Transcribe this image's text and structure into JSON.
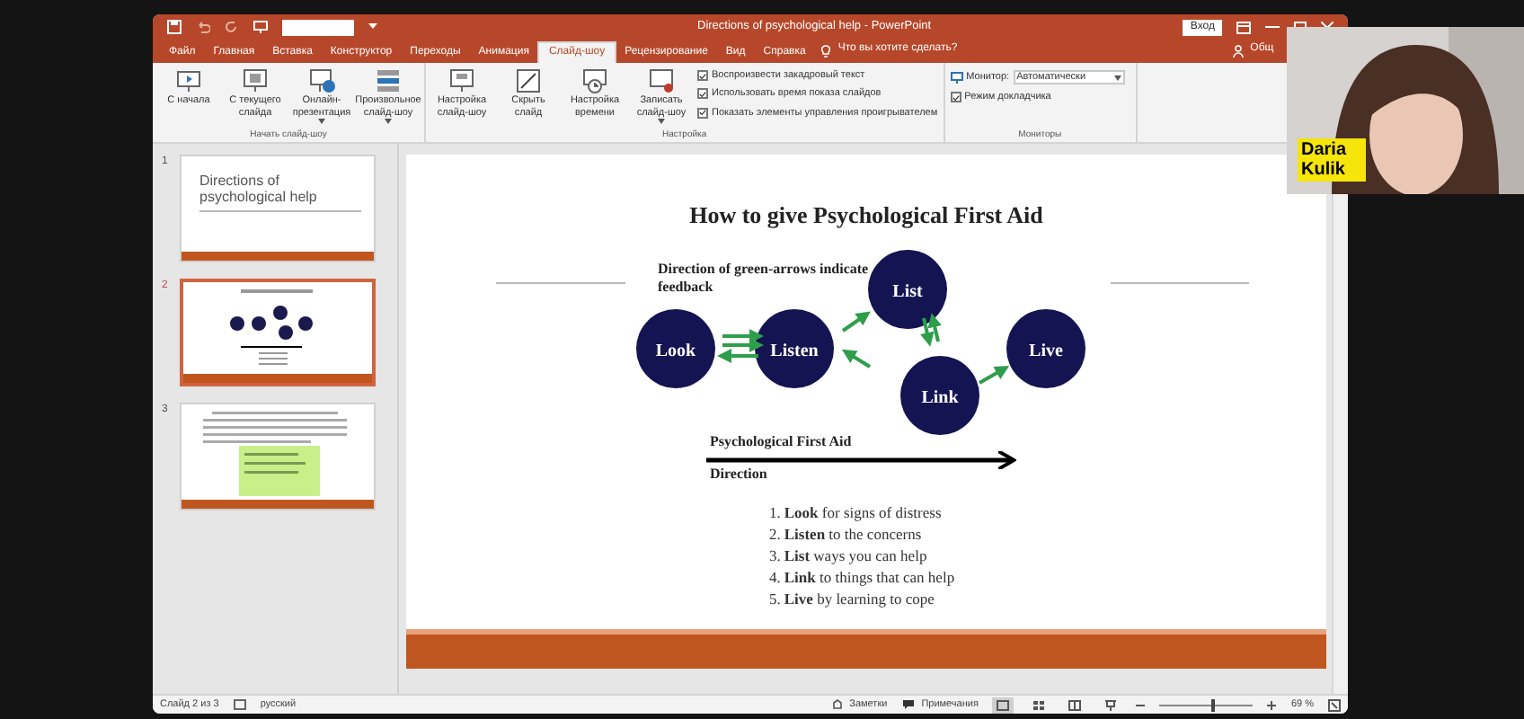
{
  "window": {
    "title": "Directions of psychological help  -  PowerPoint",
    "sign_in": "Вход",
    "share": "Общ"
  },
  "tabs": [
    {
      "label": "Файл",
      "selected": false
    },
    {
      "label": "Главная",
      "selected": false
    },
    {
      "label": "Вставка",
      "selected": false
    },
    {
      "label": "Конструктор",
      "selected": false
    },
    {
      "label": "Переходы",
      "selected": false
    },
    {
      "label": "Анимация",
      "selected": false
    },
    {
      "label": "Слайд-шоу",
      "selected": true
    },
    {
      "label": "Рецензирование",
      "selected": false
    },
    {
      "label": "Вид",
      "selected": false
    },
    {
      "label": "Справка",
      "selected": false
    }
  ],
  "tell_me": "Что вы хотите сделать?",
  "ribbon": {
    "groups": [
      {
        "label": "Начать слайд-шоу",
        "buttons": [
          {
            "label": "С начала",
            "dropdown": false
          },
          {
            "label": "С текущего слайда",
            "dropdown": false
          },
          {
            "label": "Онлайн-презентация",
            "dropdown": true
          },
          {
            "label": "Произвольное слайд-шоу",
            "dropdown": true
          }
        ]
      },
      {
        "label": "Настройка",
        "buttons": [
          {
            "label": "Настройка слайд-шоу",
            "dropdown": false
          },
          {
            "label": "Скрыть слайд",
            "dropdown": false
          },
          {
            "label": "Настройка времени",
            "dropdown": false
          },
          {
            "label": "Записать слайд-шоу",
            "dropdown": true
          }
        ],
        "checkboxes": [
          {
            "label": "Воспроизвести закадровый текст",
            "checked": true
          },
          {
            "label": "Использовать время показа слайдов",
            "checked": true
          },
          {
            "label": "Показать элементы управления проигрывателем",
            "checked": true
          }
        ]
      },
      {
        "label": "Мониторы",
        "monitor_label": "Монитор:",
        "monitor_value": "Автоматически",
        "checkboxes": [
          {
            "label": "Режим докладчика",
            "checked": true
          }
        ]
      }
    ]
  },
  "thumbnails": [
    {
      "number": "1",
      "selected": false,
      "kind": "title",
      "title": "Directions of psychological help"
    },
    {
      "number": "2",
      "selected": true,
      "kind": "diagram"
    },
    {
      "number": "3",
      "selected": false,
      "kind": "text"
    }
  ],
  "slide": {
    "title": "How to give Psychological First Aid",
    "note": "Direction of green-arrows indicate feedback",
    "nodes": [
      {
        "label": "Look"
      },
      {
        "label": "Listen"
      },
      {
        "label": "List"
      },
      {
        "label": "Link"
      },
      {
        "label": "Live"
      }
    ],
    "arrow_label": "Psychological First Aid",
    "arrow_label_2": "Direction",
    "steps": [
      {
        "number": "1.",
        "text": "**Look** for signs of distress"
      },
      {
        "number": "2.",
        "text": "**Listen** to the concerns"
      },
      {
        "number": "3.",
        "text": "**List** ways you can help"
      },
      {
        "number": "4.",
        "text": "**Link** to things that can help"
      },
      {
        "number": "5.",
        "text": "**Live** by learning to cope"
      }
    ]
  },
  "status_bar": {
    "slide": "Слайд 2 из 3",
    "language": "русский",
    "notes": "Заметки",
    "comments": "Примечания",
    "views": [
      {
        "selected": true
      },
      {
        "selected": false
      },
      {
        "selected": false
      },
      {
        "selected": false
      }
    ],
    "zoom": "69 %",
    "level": 0.55
  },
  "video": {
    "name": "Daria Kulik"
  }
}
